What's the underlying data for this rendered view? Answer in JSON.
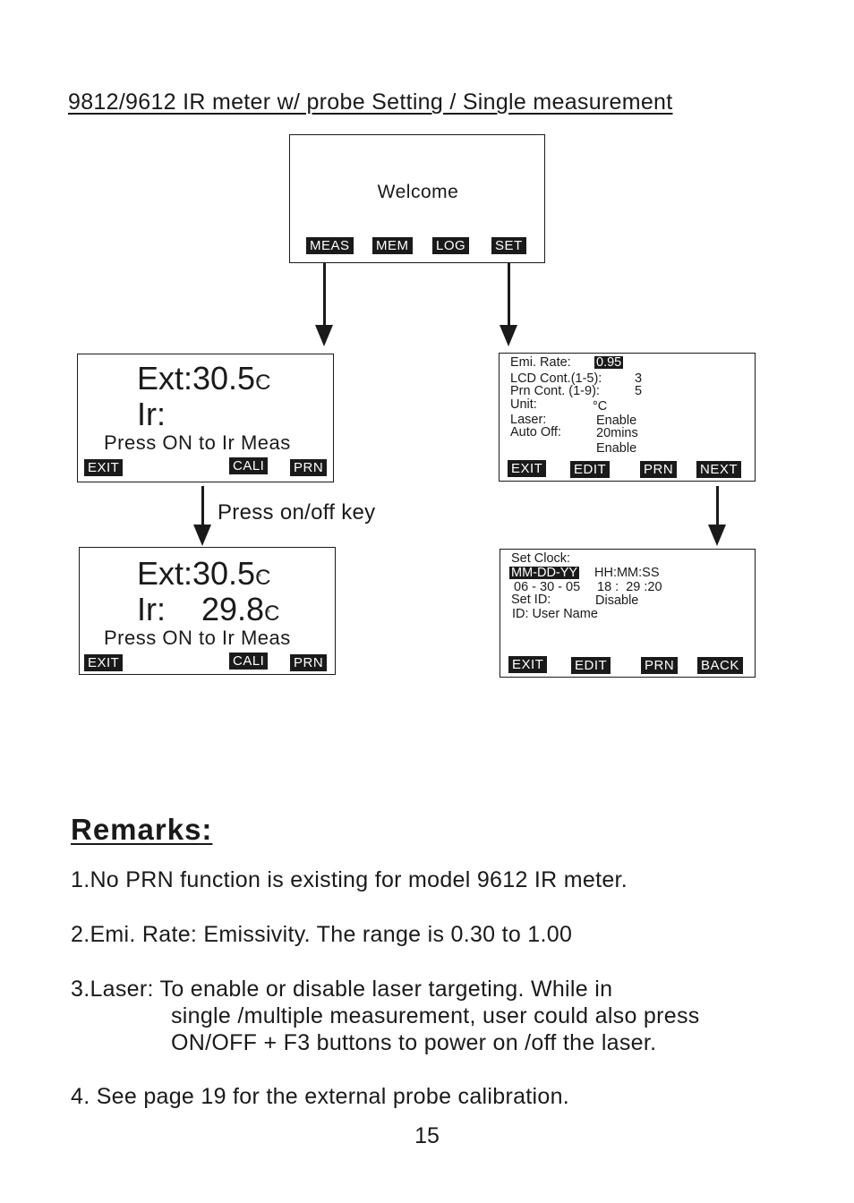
{
  "title": "9812/9612 IR meter w/ probe  Setting / Single measurement",
  "welcome_screen": {
    "text": "Welcome",
    "keys": [
      "MEAS",
      "MEM",
      "LOG",
      "SET"
    ]
  },
  "meas_screen_1": {
    "ext_label": "Ext:",
    "ext_value": "30.5",
    "ir_label": "Ir:",
    "ir_value": "",
    "unit": "C",
    "degree": "°",
    "prompt": "Press ON to Ir Meas",
    "keys": [
      "EXIT",
      "CALI",
      "PRN"
    ]
  },
  "transition_label": "Press on/off key",
  "meas_screen_2": {
    "ext_label": "Ext:",
    "ext_value": "30.5",
    "ir_label": "Ir:",
    "ir_value": "29.8",
    "unit": "C",
    "degree": "°",
    "prompt": "Press ON to Ir Meas",
    "keys": [
      "EXIT",
      "CALI",
      "PRN"
    ]
  },
  "settings_screen": {
    "rows": [
      {
        "label": "Emi. Rate:",
        "value": "0.95"
      },
      {
        "label": "LCD Cont.(1-5):",
        "value": "3"
      },
      {
        "label": "Prn Cont.  (1-9):",
        "value": "5"
      },
      {
        "label": "Unit:",
        "value": "°C"
      },
      {
        "label": "Laser:",
        "value": "Enable"
      },
      {
        "label": "Auto Off:",
        "value": "20mins"
      },
      {
        "label": "",
        "value": "Enable"
      }
    ],
    "keys": [
      "EXIT",
      "EDIT",
      "PRN",
      "NEXT"
    ]
  },
  "clock_screen": {
    "heading": "Set Clock:",
    "date_format": "MM-DD-YY",
    "time_format": "HH:MM:SS",
    "date_value": "06 - 30 - 05",
    "time_value": "18 :  29 :20",
    "set_id_label": "Set ID:",
    "set_id_value": "Disable",
    "id_line": "ID: User Name",
    "keys": [
      "EXIT",
      "EDIT",
      "PRN",
      "BACK"
    ]
  },
  "remarks": {
    "heading": "Remarks:",
    "items": [
      "1.No PRN function is existing for model 9612 IR meter.",
      "2.Emi. Rate: Emissivity. The range is 0.30 to 1.00",
      "3.Laser: To enable or disable laser targeting.  While in",
      "single /multiple measurement, user could also press",
      "ON/OFF + F3 buttons to power on /off the laser.",
      "4. See page 19 for the external probe calibration."
    ]
  },
  "page_number": "15"
}
